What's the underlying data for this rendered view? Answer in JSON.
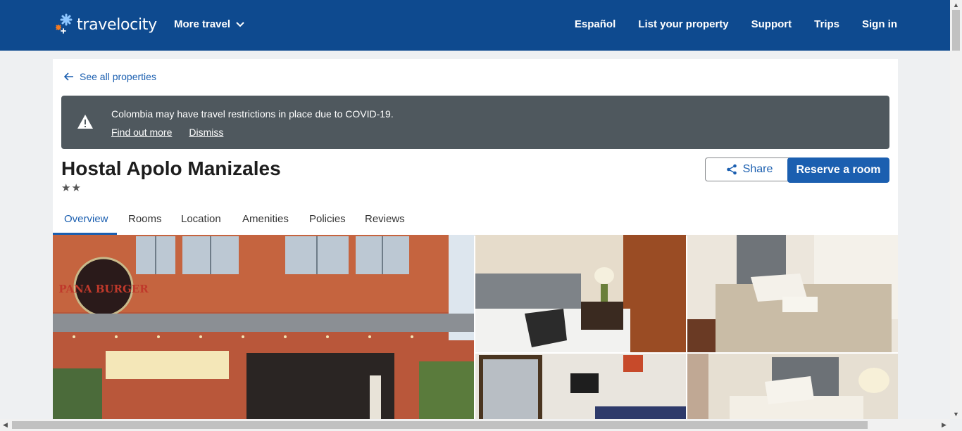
{
  "header": {
    "logo_text": "travelocity",
    "more_travel_label": "More travel",
    "nav": [
      "Español",
      "List your property",
      "Support",
      "Trips",
      "Sign in"
    ]
  },
  "back_link": "See all properties",
  "alert": {
    "message": "Colombia may have travel restrictions in place due to COVID-19.",
    "find_out_more": "Find out more",
    "dismiss": "Dismiss"
  },
  "property": {
    "name": "Hostal Apolo Manizales",
    "stars": "★★",
    "star_rating": 2
  },
  "actions": {
    "share": "Share",
    "reserve": "Reserve a room"
  },
  "tabs": [
    "Overview",
    "Rooms",
    "Location",
    "Amenities",
    "Policies",
    "Reviews"
  ],
  "active_tab": "Overview",
  "photo_sign": {
    "text": "PANA BURGER"
  },
  "colors": {
    "header_bg": "#0e4a8f",
    "accent": "#1b5fb0",
    "alert_bg": "#4f585e"
  }
}
